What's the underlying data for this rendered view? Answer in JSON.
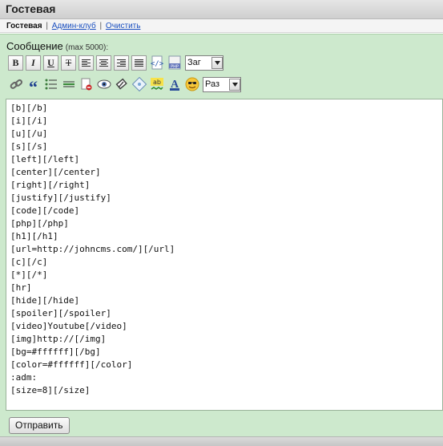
{
  "header": {
    "title": "Гостевая"
  },
  "nav": {
    "current": "Гостевая",
    "links": [
      "Админ-клуб",
      "Очистить"
    ]
  },
  "form": {
    "label": "Сообщение",
    "limit": "(max 5000):",
    "font_select": "Заг",
    "size_select": "Раз",
    "submit_label": "Отправить"
  },
  "toolbar": {
    "row1": [
      "bold-icon",
      "italic-icon",
      "underline-icon",
      "strikethrough-icon",
      "align-left-icon",
      "align-center-icon",
      "align-right-icon",
      "align-justify-icon",
      "code-icon",
      "php-icon"
    ],
    "row2": [
      "link-icon",
      "quote-icon",
      "list-icon",
      "hr-icon",
      "hide-icon",
      "spoiler-icon",
      "clean-icon",
      "image-icon",
      "spellcheck-icon",
      "text-color-icon",
      "smiley-icon"
    ]
  },
  "editor": {
    "lines": [
      "[b][/b]",
      "[i][/i]",
      "[u][/u]",
      "[s][/s]",
      "[left][/left]",
      "[center][/center]",
      "[right][/right]",
      "[justify][/justify]",
      "[code][/code]",
      "[php][/php]",
      "[h1][/h1]",
      "[url=http://johncms.com/][/url]",
      "[c][/c]",
      "[*][/*]",
      "[hr]",
      "[hide][/hide]",
      "[spoiler][/spoiler]",
      "[video]Youtube[/video]",
      "[img]http://[/img]",
      "[bg=#ffffff][/bg]",
      "[color=#ffffff][/color]",
      ":adm:",
      "[size=8][/size]"
    ]
  }
}
